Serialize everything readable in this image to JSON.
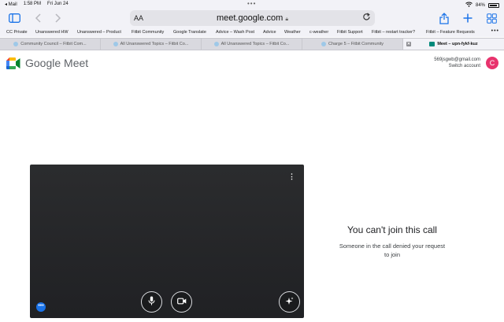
{
  "status": {
    "back_app": "◂ Mail",
    "time": "1:58 PM",
    "date": "Fri Jun 24",
    "battery": "84%",
    "dots": "•••"
  },
  "toolbar": {
    "text_size": "AA",
    "url": "meet.google.com",
    "lock_icon": "lock-icon"
  },
  "favorites": [
    "CC Private",
    "Unanswered HW",
    "Unanswered – Product",
    "Fitbit Community",
    "Google Translate",
    "Advice – Wash Post",
    "Advice",
    "Weather",
    "c-weather",
    "Fitbit Support",
    "Fitbit – restart tracker?",
    "Fitbit – Feature Requests"
  ],
  "favorites_more": "•••",
  "tabs": [
    "Community Council – Fitbit Com...",
    "All Unanswered Topics – Fitbit Co...",
    "All Unanswered Topics – Fitbit Co...",
    "Charge 5 – Fitbit Community",
    "Meet – upn-fykf-kuz"
  ],
  "meet": {
    "logo_text": "Google Meet",
    "account_email": "569jsgwb@gmail.com",
    "switch_account": "Switch account",
    "avatar_letter": "C",
    "join_title": "You can't join this call",
    "join_desc": "Someone in the call denied your request to join",
    "video_menu": "⋮",
    "more_options": "•••"
  },
  "colors": {
    "accent": "#1a73e8",
    "avatar": "#e8336d",
    "video_bg": "#202124"
  }
}
